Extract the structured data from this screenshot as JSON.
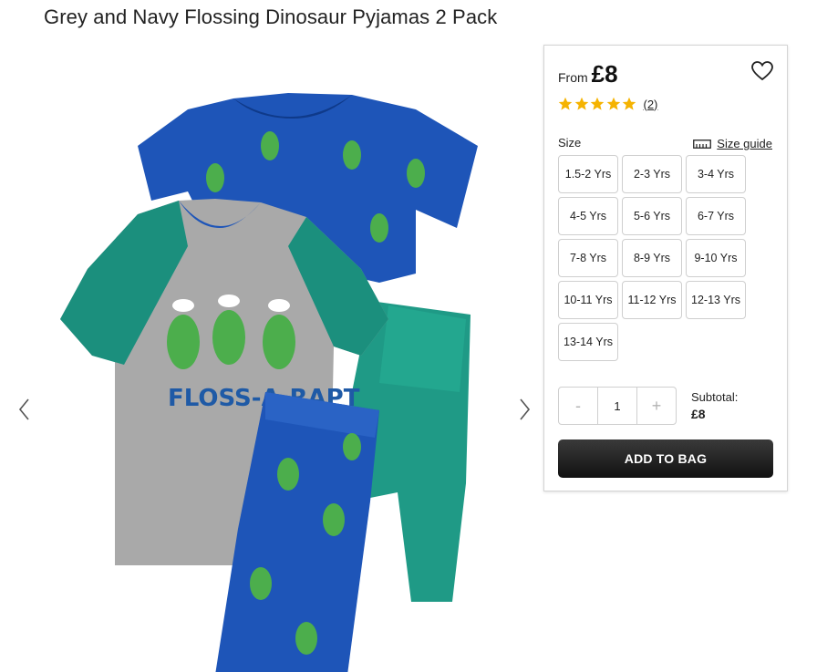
{
  "product": {
    "title": "Grey and Navy Flossing Dinosaur Pyjamas 2 Pack",
    "image_alt": "FLOSS-A-RAPT"
  },
  "gallery": {
    "prev_icon": "chevron-left-icon",
    "next_icon": "chevron-right-icon"
  },
  "panel": {
    "from_label": "From",
    "price": "£8",
    "wishlist_icon": "heart-icon",
    "rating": {
      "stars": 5,
      "review_count": "(2)",
      "star_color": "#f5b301"
    },
    "size_label": "Size",
    "size_guide_label": "Size guide",
    "sizes": [
      "1.5-2 Yrs",
      "2-3 Yrs",
      "3-4 Yrs",
      "4-5 Yrs",
      "5-6 Yrs",
      "6-7 Yrs",
      "7-8 Yrs",
      "8-9 Yrs",
      "9-10 Yrs",
      "10-11 Yrs",
      "11-12 Yrs",
      "12-13 Yrs",
      "13-14 Yrs"
    ],
    "quantity": {
      "minus": "-",
      "value": "1",
      "plus": "+"
    },
    "subtotal_label": "Subtotal:",
    "subtotal_value": "£8",
    "add_to_bag_label": "ADD TO BAG"
  }
}
